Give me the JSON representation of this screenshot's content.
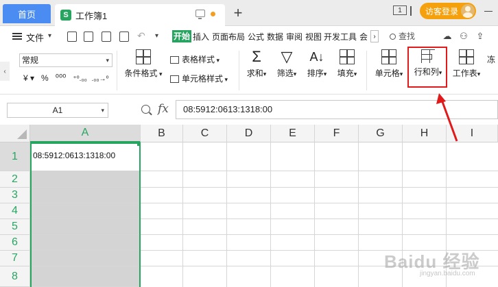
{
  "titlebar": {
    "home_tab": "首页",
    "doc_icon_letter": "S",
    "doc_tab": "工作簿1",
    "new_tab": "+",
    "window_count": "1",
    "guest_login": "访客登录"
  },
  "menubar": {
    "file": "文件",
    "tabs": [
      "开始",
      "插入",
      "页面布局",
      "公式",
      "数据",
      "审阅",
      "视图",
      "开发工具",
      "会"
    ],
    "search": "查找"
  },
  "ribbon": {
    "number_format": "常规",
    "conditional_format": "条件格式",
    "table_style": "表格样式",
    "cell_style": "单元格样式",
    "sum": "求和",
    "filter": "筛选",
    "sort": "排序",
    "fill": "填充",
    "cell": "单元格",
    "row_col": "行和列",
    "worksheet": "工作表",
    "cut_off": "冻"
  },
  "formulabar": {
    "name_box": "A1",
    "fx": "fx",
    "formula": "08:5912:0613:1318:00"
  },
  "sheet": {
    "columns": [
      "A",
      "B",
      "C",
      "D",
      "E",
      "F",
      "G",
      "H",
      "I"
    ],
    "rows": [
      "1",
      "2",
      "3",
      "4",
      "5",
      "6",
      "7",
      "8"
    ],
    "a1_value": "08:5912:0613:1318:00"
  },
  "watermark": {
    "text": "Baidu 经验",
    "sub": "jingyan.baidu.com"
  },
  "colors": {
    "accent_green": "#27a560",
    "home_tab_blue": "#4a8cf2",
    "guest_orange": "#f4a10d",
    "annotation_red": "#e0191b"
  }
}
